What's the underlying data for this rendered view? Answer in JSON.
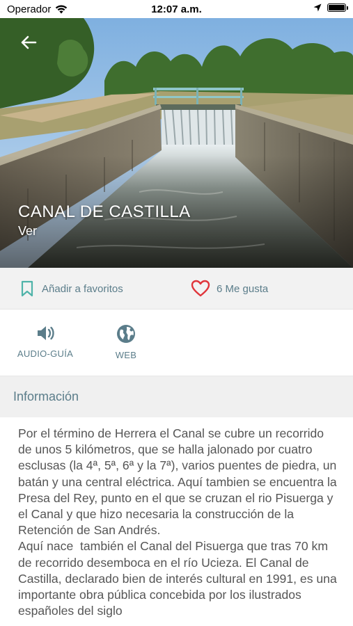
{
  "status_bar": {
    "carrier": "Operador",
    "time": "12:07 a.m."
  },
  "hero": {
    "title": "CANAL DE CASTILLA",
    "subtitle": "Ver"
  },
  "actions": {
    "favorite_label": "Añadir a favoritos",
    "likes_label": "6 Me gusta"
  },
  "tools": {
    "audio_label": "AUDIO-GUÍA",
    "web_label": "WEB"
  },
  "info": {
    "header": "Información",
    "paragraph1": "Por el término de Herrera el Canal se cubre un recorrido de unos 5 kilómetros, que se halla jalonado por cuatro esclusas (la 4ª, 5ª, 6ª y la 7ª), varios puentes de piedra, un batán y una central eléctrica. Aquí tambien se encuentra la Presa del Rey, punto en el que se cruzan el rio Pisuerga y el Canal y que hizo necesaria la construcción de la Retención de San Andrés.",
    "paragraph2": "Aquí nace  también el Canal del Pisuerga que tras 70 km de recorrido desemboca en el río Ucieza. El Canal de Castilla, declarado bien de interés cultural en 1991, es una importante obra pública concebida por los ilustrados españoles del siglo"
  },
  "colors": {
    "accent": "#5b7d8a",
    "favorite_icon": "#4fb3a9",
    "heart": "#e0343a",
    "section_bg": "#f0f0f0"
  },
  "icons": {
    "back": "arrow-left-icon",
    "favorite": "bookmark-icon",
    "likes": "heart-icon",
    "audio": "speaker-icon",
    "web": "globe-icon"
  }
}
